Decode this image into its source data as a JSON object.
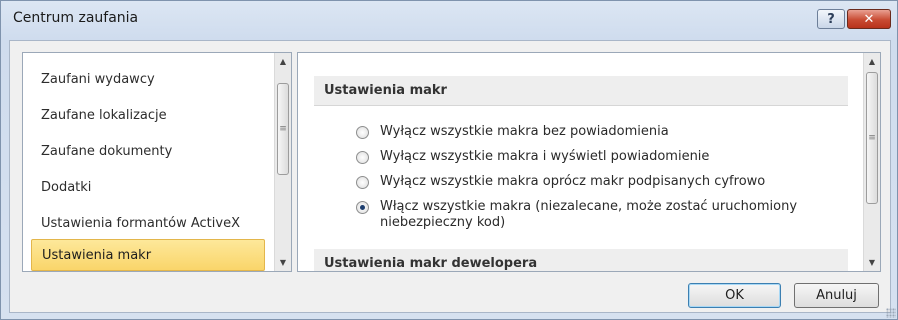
{
  "window": {
    "title": "Centrum zaufania",
    "help_glyph": "?",
    "close_glyph": "✕"
  },
  "nav": {
    "items": [
      {
        "label": "Zaufani wydawcy",
        "selected": false
      },
      {
        "label": "Zaufane lokalizacje",
        "selected": false
      },
      {
        "label": "Zaufane dokumenty",
        "selected": false
      },
      {
        "label": "Dodatki",
        "selected": false
      },
      {
        "label": "Ustawienia formantów ActiveX",
        "selected": false
      },
      {
        "label": "Ustawienia makr",
        "selected": true
      }
    ]
  },
  "scroll": {
    "up_glyph": "▲",
    "down_glyph": "▼",
    "thumb_glyph": "≡"
  },
  "panel": {
    "section1_title": "Ustawienia makr",
    "options": [
      {
        "label": "Wyłącz wszystkie makra bez powiadomienia",
        "checked": false
      },
      {
        "label": "Wyłącz wszystkie makra i wyświetl powiadomienie",
        "checked": false
      },
      {
        "label": "Wyłącz wszystkie makra oprócz makr podpisanych cyfrowo",
        "checked": false
      },
      {
        "label": "Włącz wszystkie makra (niezalecane, może zostać uruchomiony niebezpieczny kod)",
        "checked": true
      }
    ],
    "section2_title": "Ustawienia makr dewelopera"
  },
  "footer": {
    "ok_label": "OK",
    "cancel_label": "Anuluj"
  },
  "colors": {
    "selected_item": "#fad56a",
    "close_button": "#c84b33",
    "titlebar": "#dce6f3"
  }
}
